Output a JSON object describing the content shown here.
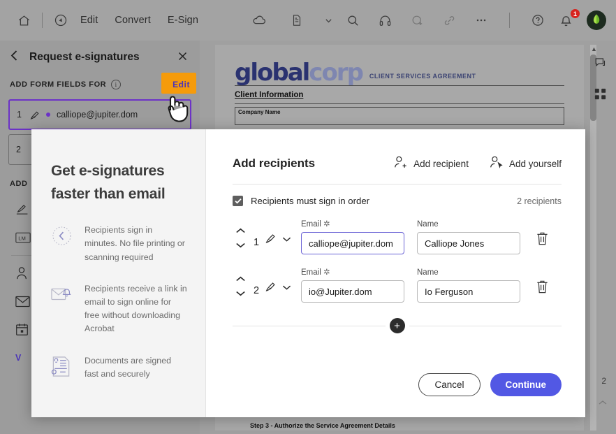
{
  "toolbar": {
    "home_icon": "home-icon",
    "scan_icon": "scan-tool-icon",
    "menus": [
      {
        "label": "Edit"
      },
      {
        "label": "Convert"
      },
      {
        "label": "E-Sign"
      }
    ],
    "center_icons": [
      {
        "name": "cloud-icon"
      },
      {
        "name": "document-icon"
      },
      {
        "name": "chevron-down-icon"
      }
    ],
    "right_icons": [
      {
        "name": "search-icon"
      },
      {
        "name": "headphones-icon"
      },
      {
        "name": "add-stamp-icon"
      },
      {
        "name": "link-icon"
      },
      {
        "name": "more-options-icon"
      },
      {
        "name": "help-icon"
      },
      {
        "name": "notifications-icon"
      }
    ],
    "notification_count": "1"
  },
  "sidebar": {
    "back_icon": "chevron-left-icon",
    "title": "Request e-signatures",
    "close_icon": "close-icon",
    "section_label": "ADD FORM FIELDS FOR",
    "info_icon": "info-icon",
    "edit_label": "Edit",
    "recipients": [
      {
        "num": "1",
        "email": "calliope@jupiter.dom",
        "active": true
      },
      {
        "num": "2",
        "email": "",
        "active": false
      }
    ],
    "fields_label": "ADD",
    "field_items": [
      {
        "icon": "signature-field-icon",
        "label": ""
      },
      {
        "icon": "initials-field-icon",
        "label": "LM"
      },
      {
        "icon": "name-field-icon",
        "label": ""
      },
      {
        "icon": "email-field-icon",
        "label": ""
      },
      {
        "icon": "date-field-icon",
        "label": ""
      }
    ],
    "more_link": "V"
  },
  "document": {
    "logo_part1": "global",
    "logo_part2": "corp",
    "title": "CLIENT SERVICES AGREEMENT",
    "heading": "Client Information",
    "field_label": "Company Name",
    "footer_line": "Step 3 - Authorize the Service Agreement Details",
    "page_number": "2",
    "rail_icons": [
      {
        "name": "comment-icon"
      },
      {
        "name": "apps-grid-icon"
      }
    ]
  },
  "modal": {
    "left": {
      "headline": "Get e-signatures faster than email",
      "features": [
        {
          "icon": "clock-icon",
          "text": "Recipients sign in minutes. No file printing or scanning required"
        },
        {
          "icon": "email-bell-icon",
          "text": "Recipients receive a link in email to sign online for free without downloading Acrobat"
        },
        {
          "icon": "secure-document-icon",
          "text": "Documents are signed fast and securely"
        }
      ]
    },
    "right": {
      "title": "Add recipients",
      "add_recipient_label": "Add recipient",
      "add_recipient_icon": "add-person-icon",
      "add_yourself_label": "Add yourself",
      "add_yourself_icon": "person-cursor-icon",
      "sign_in_order_label": "Recipients must sign in order",
      "sign_in_order_checked": true,
      "recipient_count_label": "2 recipients",
      "email_label": "Email",
      "email_required_mark": "✲",
      "name_label": "Name",
      "recipients": [
        {
          "index": "1",
          "role_icon": "pen-nib-icon",
          "chevron_icon": "chevron-down-icon",
          "email": "calliope@jupiter.dom",
          "name": "Calliope Jones",
          "email_focused": true,
          "delete_icon": "trash-icon"
        },
        {
          "index": "2",
          "role_icon": "pen-nib-icon",
          "chevron_icon": "chevron-down-icon",
          "email": "io@Jupiter.dom",
          "name": "Io Ferguson",
          "email_focused": false,
          "delete_icon": "trash-icon"
        }
      ],
      "add_row_icon": "plus-icon",
      "cancel_label": "Cancel",
      "continue_label": "Continue"
    }
  },
  "colors": {
    "accent_purple": "#6c32c7",
    "highlight_orange": "#f59b0b",
    "primary_button": "#5258e4",
    "link": "#4b35b8"
  }
}
